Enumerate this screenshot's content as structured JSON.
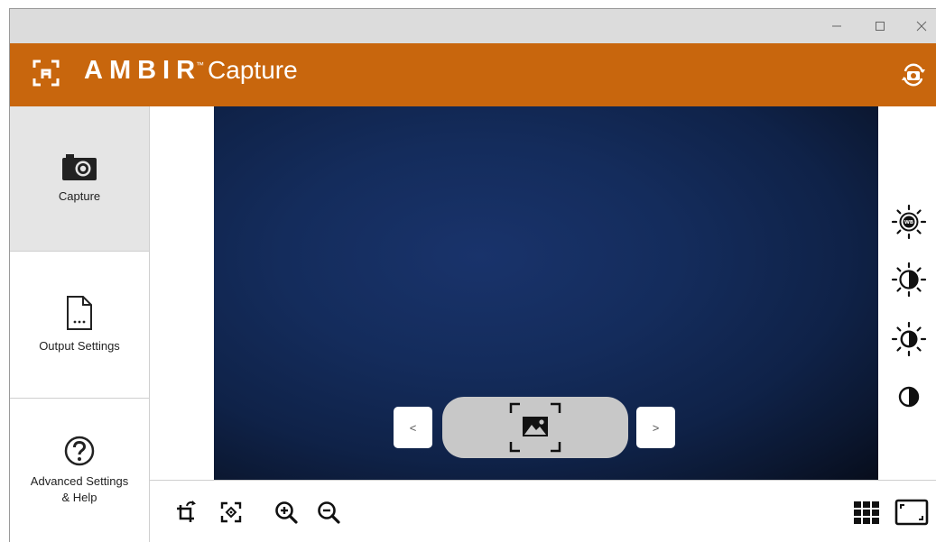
{
  "app": {
    "brand_name": "AMBIR",
    "brand_tm": "™",
    "product_name": "Capture"
  },
  "window_controls": {
    "minimize_icon": "minimize-icon",
    "maximize_icon": "maximize-icon",
    "close_icon": "close-icon"
  },
  "sidebar": {
    "items": [
      {
        "label": "Capture",
        "icon": "camera-icon",
        "selected": true
      },
      {
        "label": "Output Settings",
        "icon": "document-icon",
        "selected": false
      },
      {
        "label": "Advanced Settings\n& Help",
        "icon": "help-icon",
        "selected": false
      }
    ]
  },
  "preview": {
    "prev_label": "<",
    "next_label": ">",
    "capture_icon": "capture-photo-icon"
  },
  "adjustments": [
    {
      "name": "white-balance",
      "icon": "white-balance-icon"
    },
    {
      "name": "brightness",
      "icon": "brightness-icon"
    },
    {
      "name": "exposure",
      "icon": "exposure-icon"
    },
    {
      "name": "contrast",
      "icon": "contrast-icon"
    }
  ],
  "toolbar": {
    "left": [
      "rotate-icon",
      "autofocus-icon",
      "zoom-in-icon",
      "zoom-out-icon"
    ],
    "right": [
      "grid-icon",
      "fullscreen-icon"
    ]
  },
  "colors": {
    "brand": "#c8660d",
    "titlebar": "#dcdcdc",
    "selected_nav": "#e5e5e5",
    "preview_bg": "#142c5c",
    "capture_button": "#c8c8c8"
  }
}
